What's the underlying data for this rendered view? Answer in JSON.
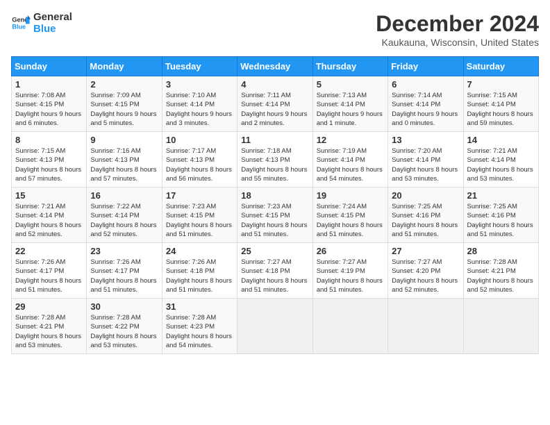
{
  "logo": {
    "name1": "General",
    "name2": "Blue"
  },
  "title": "December 2024",
  "subtitle": "Kaukauna, Wisconsin, United States",
  "weekdays": [
    "Sunday",
    "Monday",
    "Tuesday",
    "Wednesday",
    "Thursday",
    "Friday",
    "Saturday"
  ],
  "weeks": [
    [
      {
        "day": "1",
        "sunrise": "7:08 AM",
        "sunset": "4:15 PM",
        "daylight": "9 hours and 6 minutes."
      },
      {
        "day": "2",
        "sunrise": "7:09 AM",
        "sunset": "4:15 PM",
        "daylight": "9 hours and 5 minutes."
      },
      {
        "day": "3",
        "sunrise": "7:10 AM",
        "sunset": "4:14 PM",
        "daylight": "9 hours and 3 minutes."
      },
      {
        "day": "4",
        "sunrise": "7:11 AM",
        "sunset": "4:14 PM",
        "daylight": "9 hours and 2 minutes."
      },
      {
        "day": "5",
        "sunrise": "7:13 AM",
        "sunset": "4:14 PM",
        "daylight": "9 hours and 1 minute."
      },
      {
        "day": "6",
        "sunrise": "7:14 AM",
        "sunset": "4:14 PM",
        "daylight": "9 hours and 0 minutes."
      },
      {
        "day": "7",
        "sunrise": "7:15 AM",
        "sunset": "4:14 PM",
        "daylight": "8 hours and 59 minutes."
      }
    ],
    [
      {
        "day": "8",
        "sunrise": "7:15 AM",
        "sunset": "4:13 PM",
        "daylight": "8 hours and 57 minutes."
      },
      {
        "day": "9",
        "sunrise": "7:16 AM",
        "sunset": "4:13 PM",
        "daylight": "8 hours and 57 minutes."
      },
      {
        "day": "10",
        "sunrise": "7:17 AM",
        "sunset": "4:13 PM",
        "daylight": "8 hours and 56 minutes."
      },
      {
        "day": "11",
        "sunrise": "7:18 AM",
        "sunset": "4:13 PM",
        "daylight": "8 hours and 55 minutes."
      },
      {
        "day": "12",
        "sunrise": "7:19 AM",
        "sunset": "4:14 PM",
        "daylight": "8 hours and 54 minutes."
      },
      {
        "day": "13",
        "sunrise": "7:20 AM",
        "sunset": "4:14 PM",
        "daylight": "8 hours and 53 minutes."
      },
      {
        "day": "14",
        "sunrise": "7:21 AM",
        "sunset": "4:14 PM",
        "daylight": "8 hours and 53 minutes."
      }
    ],
    [
      {
        "day": "15",
        "sunrise": "7:21 AM",
        "sunset": "4:14 PM",
        "daylight": "8 hours and 52 minutes."
      },
      {
        "day": "16",
        "sunrise": "7:22 AM",
        "sunset": "4:14 PM",
        "daylight": "8 hours and 52 minutes."
      },
      {
        "day": "17",
        "sunrise": "7:23 AM",
        "sunset": "4:15 PM",
        "daylight": "8 hours and 51 minutes."
      },
      {
        "day": "18",
        "sunrise": "7:23 AM",
        "sunset": "4:15 PM",
        "daylight": "8 hours and 51 minutes."
      },
      {
        "day": "19",
        "sunrise": "7:24 AM",
        "sunset": "4:15 PM",
        "daylight": "8 hours and 51 minutes."
      },
      {
        "day": "20",
        "sunrise": "7:25 AM",
        "sunset": "4:16 PM",
        "daylight": "8 hours and 51 minutes."
      },
      {
        "day": "21",
        "sunrise": "7:25 AM",
        "sunset": "4:16 PM",
        "daylight": "8 hours and 51 minutes."
      }
    ],
    [
      {
        "day": "22",
        "sunrise": "7:26 AM",
        "sunset": "4:17 PM",
        "daylight": "8 hours and 51 minutes."
      },
      {
        "day": "23",
        "sunrise": "7:26 AM",
        "sunset": "4:17 PM",
        "daylight": "8 hours and 51 minutes."
      },
      {
        "day": "24",
        "sunrise": "7:26 AM",
        "sunset": "4:18 PM",
        "daylight": "8 hours and 51 minutes."
      },
      {
        "day": "25",
        "sunrise": "7:27 AM",
        "sunset": "4:18 PM",
        "daylight": "8 hours and 51 minutes."
      },
      {
        "day": "26",
        "sunrise": "7:27 AM",
        "sunset": "4:19 PM",
        "daylight": "8 hours and 51 minutes."
      },
      {
        "day": "27",
        "sunrise": "7:27 AM",
        "sunset": "4:20 PM",
        "daylight": "8 hours and 52 minutes."
      },
      {
        "day": "28",
        "sunrise": "7:28 AM",
        "sunset": "4:21 PM",
        "daylight": "8 hours and 52 minutes."
      }
    ],
    [
      {
        "day": "29",
        "sunrise": "7:28 AM",
        "sunset": "4:21 PM",
        "daylight": "8 hours and 53 minutes."
      },
      {
        "day": "30",
        "sunrise": "7:28 AM",
        "sunset": "4:22 PM",
        "daylight": "8 hours and 53 minutes."
      },
      {
        "day": "31",
        "sunrise": "7:28 AM",
        "sunset": "4:23 PM",
        "daylight": "8 hours and 54 minutes."
      },
      null,
      null,
      null,
      null
    ]
  ],
  "labels": {
    "sunrise": "Sunrise: ",
    "sunset": "Sunset: ",
    "daylight": "Daylight hours "
  }
}
